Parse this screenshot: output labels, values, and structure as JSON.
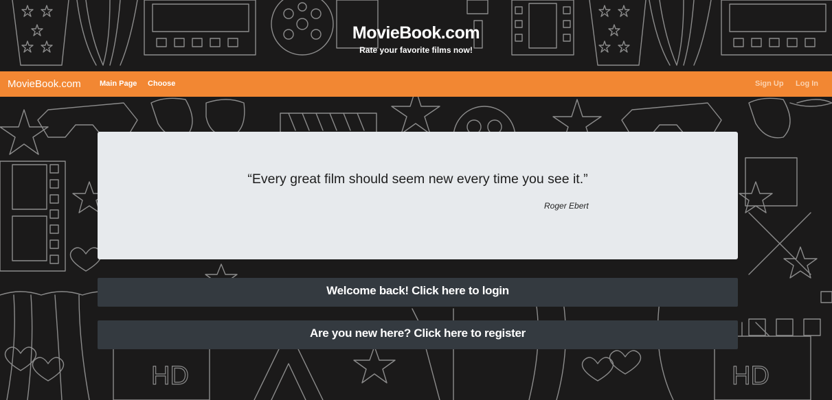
{
  "hero": {
    "title": "MovieBook.com",
    "subtitle": "Rate your favorite films now!"
  },
  "navbar": {
    "brand": "MovieBook.com",
    "links": [
      "Main Page",
      "Choose"
    ],
    "auth_links": [
      "Sign Up",
      "Log In"
    ],
    "color": "#f28733"
  },
  "quote": {
    "text": "“Every great film should seem new every time you see it.”",
    "author": "Roger Ebert"
  },
  "actions": {
    "login_label": "Welcome back! Click here to login",
    "register_label": "Are you new here? Click here to register"
  },
  "background": {
    "hd_label": "HD"
  }
}
